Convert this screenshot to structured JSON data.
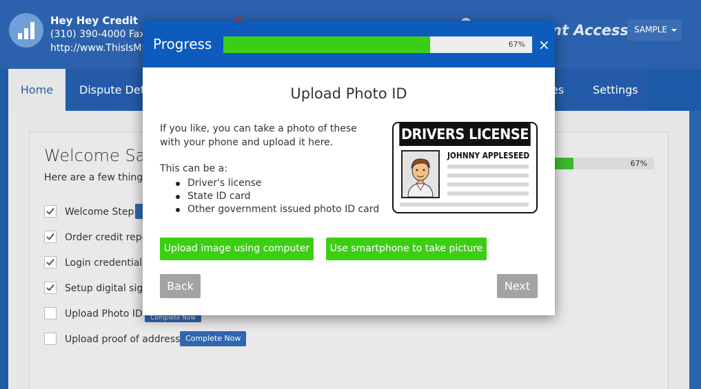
{
  "company": {
    "name": "Hey Hey Credit",
    "phone_line": "(310) 390-4000  Fax:",
    "url_line": "http://www.ThisIsMy"
  },
  "header_right": {
    "brand_fragment": "nt Access",
    "sample_button": "SAMPLE"
  },
  "nav": {
    "home": "Home",
    "dispute": "Dispute Deta",
    "es": "es",
    "settings": "Settings"
  },
  "welcome": {
    "title": "Welcome Sam",
    "subtitle": "Here are a few things t",
    "progress_pct": "67%",
    "progress_value": 0.67,
    "steps": [
      {
        "label": "Welcome Step",
        "checked": true
      },
      {
        "label": "Order credit repo",
        "checked": true
      },
      {
        "label": "Login credentials",
        "checked": true
      },
      {
        "label": "Setup digital signa",
        "checked": true
      },
      {
        "label": "Upload Photo ID",
        "checked": false
      },
      {
        "label": "Upload proof of address",
        "checked": false,
        "badge": "Complete Now"
      }
    ],
    "badge_partial": "Complete Now"
  },
  "modal": {
    "title": "Progress",
    "progress_pct": "67%",
    "progress_value": 0.67,
    "close": "×",
    "heading": "Upload Photo ID",
    "intro": "If you like, you can take a photo of these with your phone and upload it here.",
    "can_be": "This can be a:",
    "id_types": [
      "Driver's license",
      "State ID card",
      "Other government issued photo ID card"
    ],
    "license": {
      "header": "DRIVERS LICENSE",
      "name": "JOHNNY APPLESEED"
    },
    "upload_button": "Upload image using computer",
    "phone_button": "Use smartphone to take picture",
    "back_button": "Back",
    "next_button": "Next"
  },
  "colors": {
    "header_blue": "#0d5bbd",
    "accent_green": "#3cce13",
    "grey_button": "#a3a3a3",
    "app_blue": "#2c62ad"
  }
}
